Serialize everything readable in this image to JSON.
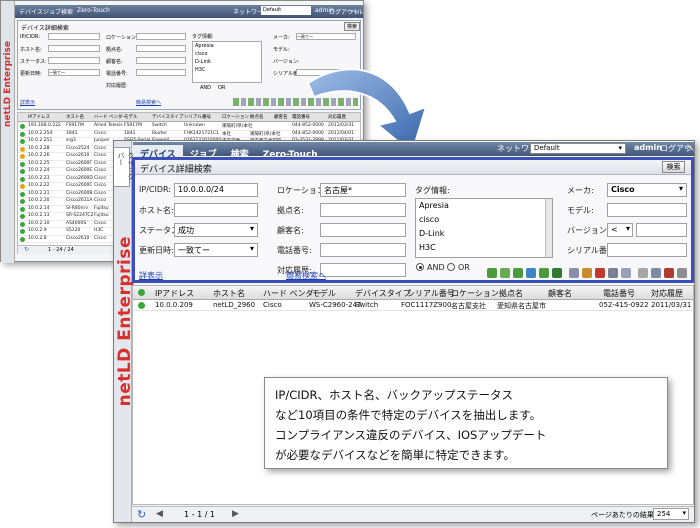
{
  "background_window": {
    "tabs": [
      "デバイス",
      "ジョブ",
      "検索",
      "Zero-Touch"
    ],
    "network_label": "ネットワーク:",
    "network_value": "Default",
    "user": "admin",
    "logout": "ログアウト",
    "help": "ヘルプ",
    "panel_title": "デバイス詳細検索",
    "search_button": "検索",
    "labels": {
      "ip": "IP/CIDR:",
      "host": "ホスト名:",
      "status": "ステータス:",
      "updated": "更新日時:",
      "location": "ロケーション:",
      "site": "拠点名:",
      "customer": "顧客名:",
      "phone": "電話番号:",
      "history": "対応履歴:",
      "tags": "タグ情報:",
      "maker": "メーカ:",
      "model": "モデル:",
      "version": "バージョン:",
      "serial": "シリアル番号:"
    },
    "tag_items": [
      "Apresia",
      "cisco",
      "D-Link",
      "H3C"
    ],
    "select_any": "一致て―",
    "and_label": "AND",
    "or_label": "OR",
    "links": [
      "詳表示",
      "簡易検索へ"
    ],
    "grid_headers": [
      "IPアドレス",
      "ホスト名",
      "ハード ベンダー",
      "モデル",
      "デバイスタイプ",
      "シリアル番号",
      "ロケーション",
      "拠点名",
      "顧客名",
      "電話番号",
      "対応履歴"
    ],
    "rows": [
      [
        "192.168.0.222",
        "FS917M",
        "Allied Telesis",
        "FS917M",
        "Switch",
        "Unknown",
        "東陽町(県)本社",
        "",
        "",
        "044-852-0000",
        "2011/03/31"
      ],
      [
        "10.0.2.254",
        "1841",
        "Cisco",
        "1841",
        "Router",
        "FHK1421721C1",
        "本社",
        "東陽町(県)本社",
        "",
        "044-852-0000",
        "2011/04/01"
      ],
      [
        "10.0.2.251",
        "srg3",
        "Juniper",
        "SSG5-Serial",
        "Firewall",
        "0162122010000",
        "東京営業",
        "東京都千代田区",
        "",
        "03-3531-2999",
        "2011/03/31"
      ],
      [
        "10.0.2.28",
        "Cisco2524",
        "Cisco",
        "2524",
        "Router",
        "06175491",
        "東京営業",
        "東京都千代田区",
        "",
        "03-3531-2999",
        "2011/03/31"
      ],
      [
        "10.0.2.26",
        "Cisco2610",
        "Cisco",
        "2610",
        "Router",
        "JAB0417106",
        "東京営業",
        "東京都千代田区",
        "",
        "03-3531-2999",
        "2011/03/31"
      ],
      [
        "10.0.2.25",
        "Cisco2600F",
        "Cisco",
        "",
        "",
        "",
        "",
        "",
        "",
        "",
        ""
      ],
      [
        "10.0.2.24",
        "Cisco2600E",
        "Cisco",
        "",
        "",
        "",
        "",
        "",
        "",
        "",
        ""
      ],
      [
        "10.0.2.23",
        "Cisco2600D",
        "Cisco",
        "",
        "",
        "",
        "",
        "",
        "",
        "",
        ""
      ],
      [
        "10.0.2.22",
        "Cisco2600C",
        "Cisco",
        "",
        "",
        "",
        "",
        "",
        "",
        "",
        ""
      ],
      [
        "10.0.2.21",
        "Cisco2600B",
        "Cisco",
        "",
        "",
        "",
        "",
        "",
        "",
        "",
        ""
      ],
      [
        "10.0.2.20",
        "Cisco2611A",
        "Cisco",
        "",
        "",
        "",
        "",
        "",
        "",
        "",
        ""
      ],
      [
        "10.0.2.14",
        "SI-R80nrv",
        "Fujitsu",
        "",
        "",
        "",
        "",
        "",
        "",
        "",
        ""
      ],
      [
        "10.0.2.13",
        "SR-S224TC2",
        "Fujitsu",
        "",
        "",
        "",
        "",
        "",
        "",
        "",
        ""
      ],
      [
        "10.0.2.10",
        "AS4000S",
        "Cisco",
        "",
        "",
        "",
        "",
        "",
        "",
        "",
        ""
      ],
      [
        "10.0.2.9",
        "S5120",
        "H3C",
        "",
        "",
        "",
        "",
        "",
        "",
        "",
        ""
      ],
      [
        "10.0.2.8",
        "Cisco2610",
        "Cisco",
        "",
        "",
        "",
        "",
        "",
        "",
        "",
        ""
      ]
    ],
    "pager": "1 - 24 / 24"
  },
  "main_window": {
    "sidebar_tab": "クイックバー",
    "brand": "netLD Enterprise",
    "tabs": [
      "デバイス",
      "ジョブ",
      "検索",
      "Zero-Touch"
    ],
    "network_label": "ネットワーク:",
    "network_value": "Default",
    "user": "admin",
    "logout": "ログアウト",
    "help": "ヘルプ",
    "panel": {
      "title": "デバイス詳細検索",
      "search_button": "検索",
      "ip_label": "IP/CIDR:",
      "ip_value": "10.0.0.0/24",
      "host_label": "ホスト名:",
      "host_value": "",
      "status_label": "ステータス:",
      "status_value": "成功",
      "updated_label": "更新日時:",
      "updated_value": "一致てー",
      "location_label": "ロケーション:",
      "location_value": "名古屋*",
      "site_label": "拠点名:",
      "customer_label": "顧客名:",
      "phone_label": "電話番号:",
      "history_label": "対応履歴:",
      "tags_label": "タグ情報:",
      "tags": [
        "Apresia",
        "cisco",
        "D-Link",
        "H3C"
      ],
      "and_label": "AND",
      "or_label": "OR",
      "maker_label": "メーカ:",
      "maker_value": "Cisco",
      "model_label": "モデル:",
      "version_label": "バージョン:",
      "version_op": "<",
      "serial_label": "シリアル番号:",
      "link_detail": "詳表示",
      "link_simple": "簡易検索へ"
    },
    "grid": {
      "headers": [
        "IPアドレス",
        "ホスト名",
        "ハード ベンダー",
        "モデル",
        "デバイスタイプ",
        "シリアル番号",
        "ロケーション",
        "拠点名",
        "顧客名",
        "電話番号",
        "対応履歴"
      ],
      "row": {
        "ip": "10.0.0.209",
        "host": "netLD_2960",
        "vendor": "Cisco",
        "model": "WS-C2960-24T",
        "type": "Switch",
        "serial": "FOC1117Z900",
        "location": "名古屋支社",
        "site": "愛知県名古屋市",
        "customer": "",
        "phone": "052-415-0922",
        "history": "2011/03/31"
      }
    },
    "pager": {
      "range": "1 - 1 / 1",
      "per_page_label": "ページあたりの結果:",
      "per_page_value": "254"
    }
  },
  "callout": {
    "line1": "IP/CIDR、ホスト名、バックアップステータス",
    "line2": "など10項目の条件で特定のデバイスを抽出します。",
    "line3": "コンプライアンス違反のデバイス、IOSアップデート",
    "line4": "が必要なデバイスなどを簡単に特定できます。"
  },
  "colors": {
    "panel_border": "#3d4fbd",
    "topbar": "#42567a",
    "brand": "#d9302c",
    "arrow": "#3c6fb8",
    "ok_status": "#3aa63a",
    "warn_status": "#e8a21a"
  }
}
